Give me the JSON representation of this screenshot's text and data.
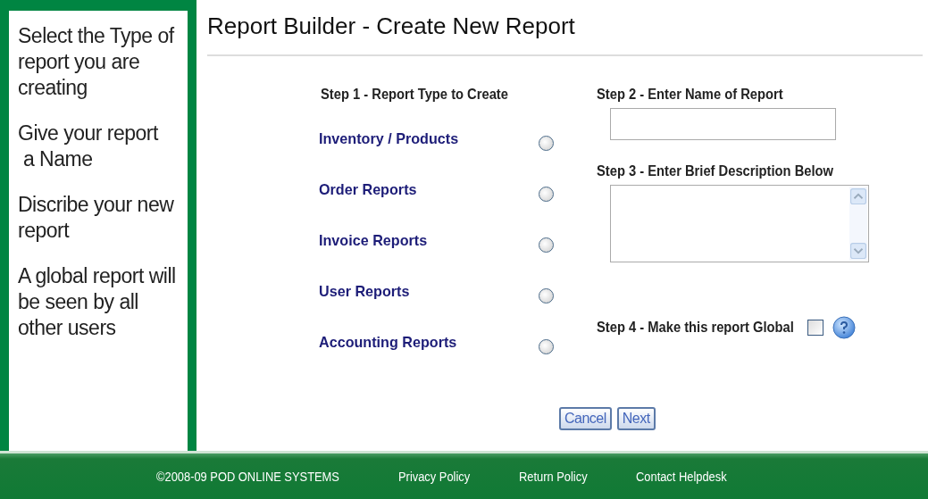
{
  "sidebar": {
    "hints": [
      "Select the Type of report you are creating",
      "Give your report\n a Name",
      "Discribe your new report",
      "A global report will be seen by all other users"
    ]
  },
  "title": "Report Builder - Create New Report",
  "step1": {
    "label": "Step 1 - Report Type to Create",
    "options": [
      {
        "label": "Inventory / Products",
        "selected": false
      },
      {
        "label": "Order Reports",
        "selected": false
      },
      {
        "label": "Invoice Reports",
        "selected": false
      },
      {
        "label": "User Reports",
        "selected": false
      },
      {
        "label": "Accounting Reports",
        "selected": false
      }
    ]
  },
  "step2": {
    "label": "Step 2 - Enter Name of Report"
  },
  "step3": {
    "label": "Step 3 - Enter Brief Description Below"
  },
  "step4": {
    "label": "Step 4 - Make this report Global",
    "checked": false
  },
  "buttons": [
    "Cancel",
    "Next"
  ],
  "footer": {
    "copyright": "©2008-09 POD ONLINE SYSTEMS",
    "links": [
      "Privacy Policy",
      "Return Policy",
      "Contact Helpdesk"
    ]
  }
}
